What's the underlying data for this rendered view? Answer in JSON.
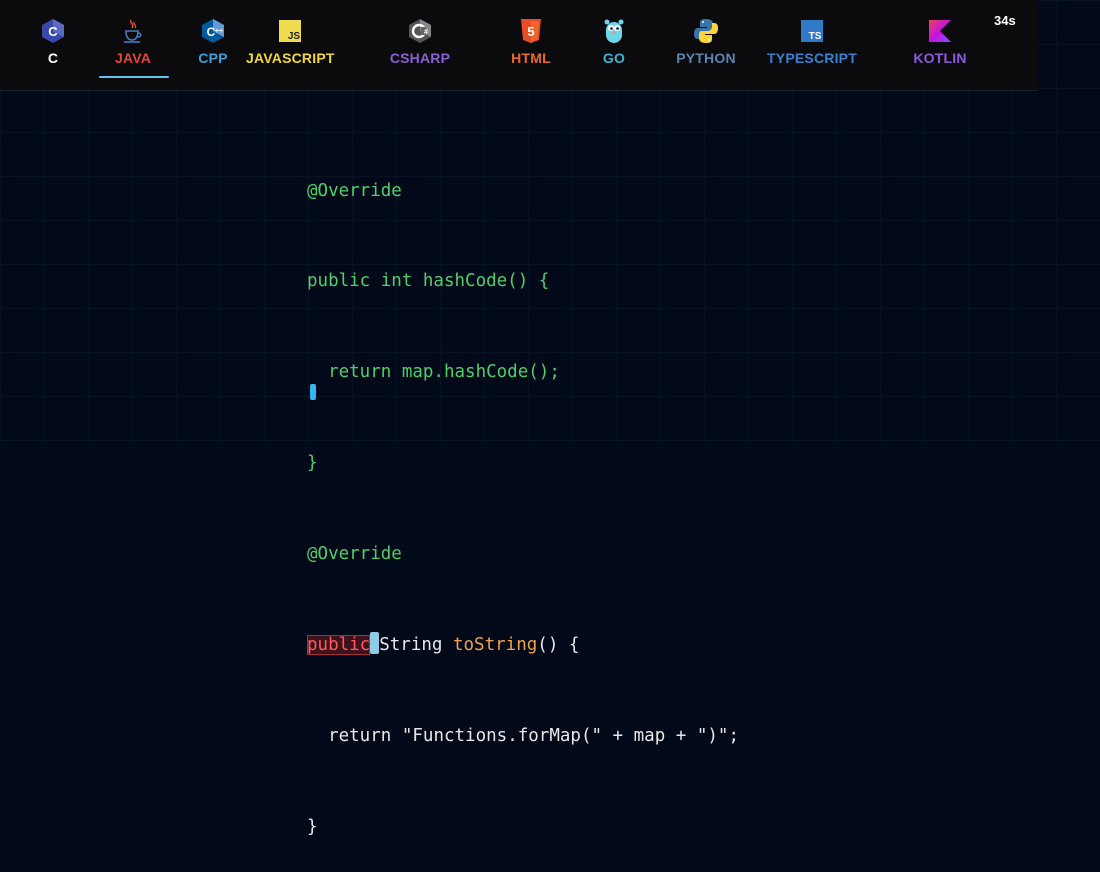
{
  "timer": "34s",
  "languages": [
    {
      "label": "C",
      "icon": "c-hexagon-icon",
      "color": "#ffffff",
      "active": false
    },
    {
      "label": "JAVA",
      "icon": "java-coffee-cup-icon",
      "color": "#e2463c",
      "active": true
    },
    {
      "label": "CPP",
      "icon": "cpp-hexagon-icon",
      "color": "#3f9ed8",
      "active": false
    },
    {
      "label": "JAVASCRIPT",
      "icon": "javascript-js-icon",
      "color": "#f0d83a",
      "active": false
    },
    {
      "label": "CSHARP",
      "icon": "csharp-hexagon-icon",
      "color": "#8a60d6",
      "active": false
    },
    {
      "label": "HTML",
      "icon": "html5-shield-icon",
      "color": "#e96a2c",
      "active": false
    },
    {
      "label": "GO",
      "icon": "go-gopher-icon",
      "color": "#37b6d6",
      "active": false
    },
    {
      "label": "PYTHON",
      "icon": "python-snakes-icon",
      "color": "#5b84b0",
      "active": false
    },
    {
      "label": "TYPESCRIPT",
      "icon": "typescript-ts-icon",
      "color": "#3b7fd0",
      "active": false
    },
    {
      "label": "KOTLIN",
      "icon": "kotlin-k-icon",
      "color": "#8d5ae0",
      "active": false
    }
  ],
  "code": {
    "line1": "@Override",
    "line2": "public int hashCode() {",
    "line3": "  return map.hashCode();",
    "line4": "}",
    "line5": "@Override",
    "line6_error": "public",
    "line6_type": "String ",
    "line6_method": "toString",
    "line6_rest": "() {",
    "line7_indent": "  ",
    "line7_kw": "return",
    "line7_space": " ",
    "line7_str1": "\"Functions.forMap(\"",
    "line7_op1": " + ",
    "line7_var": "map",
    "line7_op2": " + ",
    "line7_str2": "\")\"",
    "line7_end": ";",
    "line8": "}"
  },
  "colors": {
    "background": "#020a1a",
    "typed": "#4fcf6a",
    "error": "#ff5b5b",
    "cursor": "#8ecde6"
  }
}
